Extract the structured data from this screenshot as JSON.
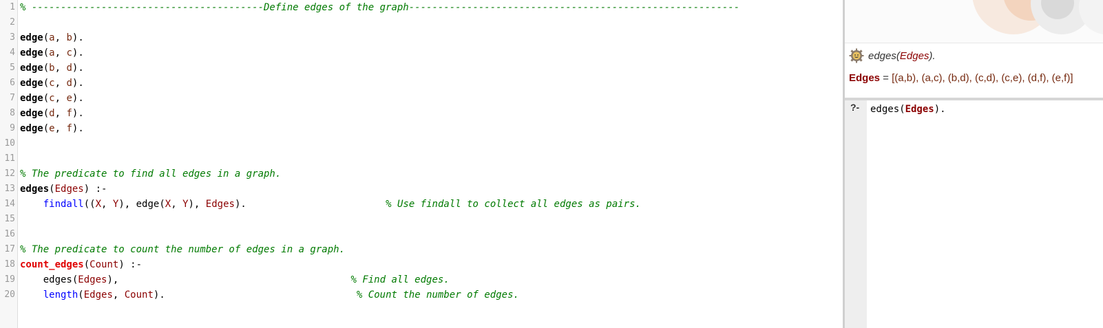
{
  "editor": {
    "lines": [
      {
        "n": "1",
        "tokens": [
          {
            "t": "% ----------------------------------------Define edges of the graph---------------------------------------------------------",
            "c": "cmt"
          }
        ]
      },
      {
        "n": "2",
        "tokens": []
      },
      {
        "n": "3",
        "tokens": [
          {
            "t": "edge",
            "c": "fn-def"
          },
          {
            "t": "(",
            "c": "punc"
          },
          {
            "t": "a",
            "c": "atom"
          },
          {
            "t": ", ",
            "c": "punc"
          },
          {
            "t": "b",
            "c": "atom"
          },
          {
            "t": ").",
            "c": "punc"
          }
        ]
      },
      {
        "n": "4",
        "tokens": [
          {
            "t": "edge",
            "c": "fn-def"
          },
          {
            "t": "(",
            "c": "punc"
          },
          {
            "t": "a",
            "c": "atom"
          },
          {
            "t": ", ",
            "c": "punc"
          },
          {
            "t": "c",
            "c": "atom"
          },
          {
            "t": ").",
            "c": "punc"
          }
        ]
      },
      {
        "n": "5",
        "tokens": [
          {
            "t": "edge",
            "c": "fn-def"
          },
          {
            "t": "(",
            "c": "punc"
          },
          {
            "t": "b",
            "c": "atom"
          },
          {
            "t": ", ",
            "c": "punc"
          },
          {
            "t": "d",
            "c": "atom"
          },
          {
            "t": ").",
            "c": "punc"
          }
        ]
      },
      {
        "n": "6",
        "tokens": [
          {
            "t": "edge",
            "c": "fn-def"
          },
          {
            "t": "(",
            "c": "punc"
          },
          {
            "t": "c",
            "c": "atom"
          },
          {
            "t": ", ",
            "c": "punc"
          },
          {
            "t": "d",
            "c": "atom"
          },
          {
            "t": ").",
            "c": "punc"
          }
        ]
      },
      {
        "n": "7",
        "tokens": [
          {
            "t": "edge",
            "c": "fn-def"
          },
          {
            "t": "(",
            "c": "punc"
          },
          {
            "t": "c",
            "c": "atom"
          },
          {
            "t": ", ",
            "c": "punc"
          },
          {
            "t": "e",
            "c": "atom"
          },
          {
            "t": ").",
            "c": "punc"
          }
        ]
      },
      {
        "n": "8",
        "tokens": [
          {
            "t": "edge",
            "c": "fn-def"
          },
          {
            "t": "(",
            "c": "punc"
          },
          {
            "t": "d",
            "c": "atom"
          },
          {
            "t": ", ",
            "c": "punc"
          },
          {
            "t": "f",
            "c": "atom"
          },
          {
            "t": ").",
            "c": "punc"
          }
        ]
      },
      {
        "n": "9",
        "tokens": [
          {
            "t": "edge",
            "c": "fn-def"
          },
          {
            "t": "(",
            "c": "punc"
          },
          {
            "t": "e",
            "c": "atom"
          },
          {
            "t": ", ",
            "c": "punc"
          },
          {
            "t": "f",
            "c": "atom"
          },
          {
            "t": ").",
            "c": "punc"
          }
        ]
      },
      {
        "n": "10",
        "tokens": []
      },
      {
        "n": "11",
        "tokens": []
      },
      {
        "n": "12",
        "tokens": [
          {
            "t": "% The predicate to find all edges in a graph.",
            "c": "cmt"
          }
        ]
      },
      {
        "n": "13",
        "tokens": [
          {
            "t": "edges",
            "c": "fn-def"
          },
          {
            "t": "(",
            "c": "punc"
          },
          {
            "t": "Edges",
            "c": "var"
          },
          {
            "t": ") :-",
            "c": "punc"
          }
        ]
      },
      {
        "n": "14",
        "tokens": [
          {
            "t": "    ",
            "c": "punc"
          },
          {
            "t": "findall",
            "c": "builtin"
          },
          {
            "t": "((",
            "c": "punc"
          },
          {
            "t": "X",
            "c": "var"
          },
          {
            "t": ", ",
            "c": "punc"
          },
          {
            "t": "Y",
            "c": "var"
          },
          {
            "t": "), edge(",
            "c": "punc"
          },
          {
            "t": "X",
            "c": "var"
          },
          {
            "t": ", ",
            "c": "punc"
          },
          {
            "t": "Y",
            "c": "var"
          },
          {
            "t": "), ",
            "c": "punc"
          },
          {
            "t": "Edges",
            "c": "var"
          },
          {
            "t": ").                        ",
            "c": "punc"
          },
          {
            "t": "% Use findall to collect all edges as pairs.",
            "c": "cmt"
          }
        ]
      },
      {
        "n": "15",
        "tokens": []
      },
      {
        "n": "16",
        "tokens": []
      },
      {
        "n": "17",
        "tokens": [
          {
            "t": "% The predicate to count the number of edges in a graph.",
            "c": "cmt"
          }
        ]
      },
      {
        "n": "18",
        "tokens": [
          {
            "t": "count_edges",
            "c": "fn-dyn"
          },
          {
            "t": "(",
            "c": "punc"
          },
          {
            "t": "Count",
            "c": "var"
          },
          {
            "t": ") :-",
            "c": "punc"
          }
        ]
      },
      {
        "n": "19",
        "tokens": [
          {
            "t": "    edges(",
            "c": "punc"
          },
          {
            "t": "Edges",
            "c": "var"
          },
          {
            "t": "),                                        ",
            "c": "punc"
          },
          {
            "t": "% Find all edges.",
            "c": "cmt"
          }
        ]
      },
      {
        "n": "20",
        "tokens": [
          {
            "t": "    ",
            "c": "punc"
          },
          {
            "t": "length",
            "c": "builtin"
          },
          {
            "t": "(",
            "c": "punc"
          },
          {
            "t": "Edges",
            "c": "var"
          },
          {
            "t": ", ",
            "c": "punc"
          },
          {
            "t": "Count",
            "c": "var"
          },
          {
            "t": ").                                 ",
            "c": "punc"
          },
          {
            "t": "% Count the number of edges.",
            "c": "cmt"
          }
        ]
      }
    ]
  },
  "answer": {
    "query_name": "edges",
    "query_open": "(",
    "query_var": "Edges",
    "query_close": ").",
    "result_var": "Edges",
    "result_eq": " = ",
    "result_value": "[(a,b), (a,c), (b,d), (c,d), (c,e), (d,f), (e,f)]",
    "icon": "gear-icon"
  },
  "console": {
    "prompt": "?-",
    "input_pre": "edges(",
    "input_var": "Edges",
    "input_post": ")."
  },
  "colors": {
    "comment": "#007a00",
    "variable": "#8b0000",
    "builtin": "#0000ff",
    "dynamic": "#e00000"
  }
}
